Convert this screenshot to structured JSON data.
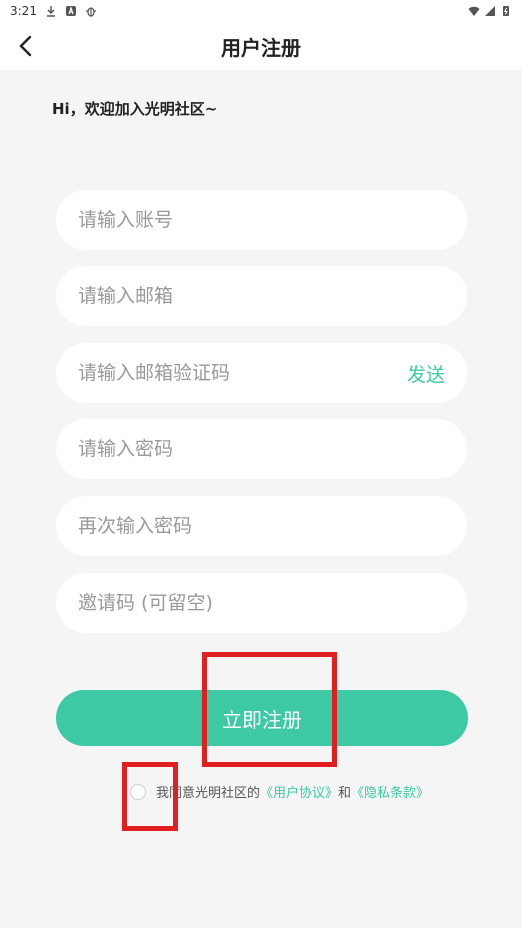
{
  "status_bar": {
    "time": "3:21"
  },
  "header": {
    "title": "用户注册"
  },
  "welcome_text": "Hi，欢迎加入光明社区~",
  "form": {
    "account_placeholder": "请输入账号",
    "email_placeholder": "请输入邮箱",
    "email_code_placeholder": "请输入邮箱验证码",
    "send_label": "发送",
    "password_placeholder": "请输入密码",
    "confirm_password_placeholder": "再次输入密码",
    "invite_code_placeholder": "邀请码 (可留空)"
  },
  "submit_label": "立即注册",
  "agreement": {
    "prefix": "我同意光明社区的",
    "user_agreement": "《用户协议》",
    "conjunction": "和",
    "privacy_policy": "《隐私条款》"
  },
  "colors": {
    "accent": "#3cc9a4",
    "highlight": "#e02020",
    "background": "#f5f5f5"
  }
}
